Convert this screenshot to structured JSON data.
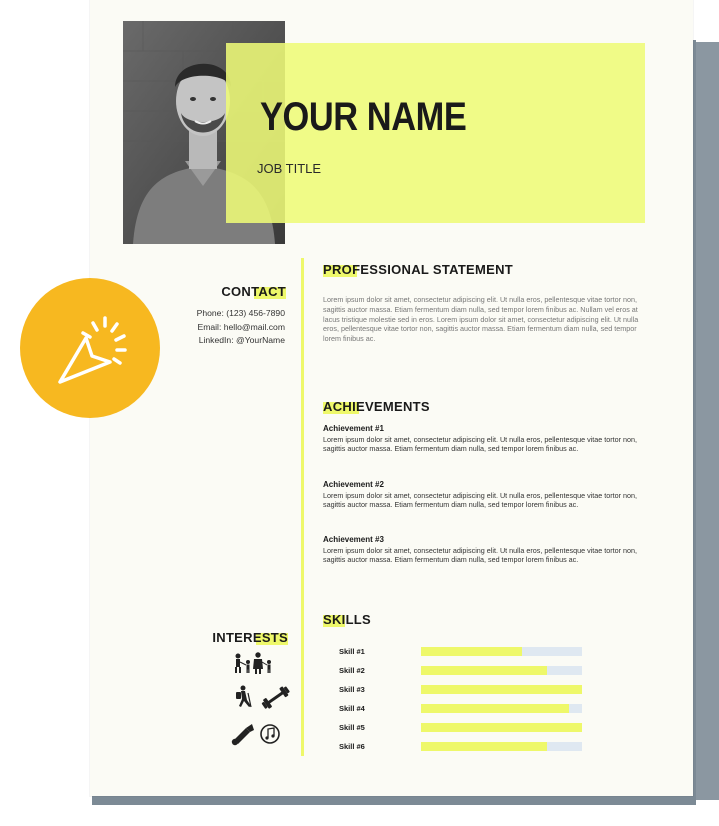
{
  "resume": {
    "name": "YOUR NAME",
    "job_title": "JOB TITLE",
    "contact": {
      "title": "CONTACT",
      "phone": "Phone: (123) 456-7890",
      "email": "Email: hello@mail.com",
      "linkedin": "LinkedIn: @YourName"
    },
    "professional": {
      "title": "PROFESSIONAL STATEMENT",
      "text": "Lorem ipsum dolor sit amet, consectetur adipiscing elit. Ut nulla eros, pellentesque vitae tortor non, sagittis auctor massa. Etiam fermentum diam nulla, sed tempor lorem finibus ac. Nullam vel eros at lacus tristique molestie sed in eros. Lorem ipsum dolor sit amet, consectetur adipiscing elit. Ut nulla eros, pellentesque vitae tortor non, sagittis auctor massa. Etiam fermentum diam nulla, sed tempor lorem finibus ac."
    },
    "achievements": {
      "title": "ACHIEVEMENTS",
      "items": [
        {
          "title": "Achievement #1",
          "text": "Lorem ipsum dolor sit amet, consectetur adipiscing elit. Ut nulla eros, pellentesque vitae tortor non, sagittis auctor massa. Etiam fermentum diam nulla, sed tempor lorem finibus ac."
        },
        {
          "title": "Achievement #2",
          "text": "Lorem ipsum dolor sit amet, consectetur adipiscing elit. Ut nulla eros, pellentesque vitae tortor non, sagittis auctor massa. Etiam fermentum diam nulla, sed tempor lorem finibus ac."
        },
        {
          "title": "Achievement #3",
          "text": "Lorem ipsum dolor sit amet, consectetur adipiscing elit. Ut nulla eros, pellentesque vitae tortor non, sagittis auctor massa. Etiam fermentum diam nulla, sed tempor lorem finibus ac."
        }
      ]
    },
    "skills": {
      "title": "SKILLS",
      "items": [
        {
          "label": "Skill #1",
          "level": 0.63
        },
        {
          "label": "Skill #2",
          "level": 0.78
        },
        {
          "label": "Skill #3",
          "level": 1.0
        },
        {
          "label": "Skill #4",
          "level": 0.92
        },
        {
          "label": "Skill #5",
          "level": 1.0
        },
        {
          "label": "Skill #6",
          "level": 0.78
        }
      ]
    },
    "interests": {
      "title": "INTERESTS",
      "icons": [
        "family-icon",
        "hiking-icon",
        "fitness-icon",
        "badminton-icon",
        "music-icon"
      ]
    }
  },
  "colors": {
    "accent": "#eef86a",
    "badge": "#f7b820",
    "paper": "#fbfbf5",
    "shadow": "#7c8a95"
  },
  "decor": {
    "badge_icon": "cursor-click-icon"
  }
}
